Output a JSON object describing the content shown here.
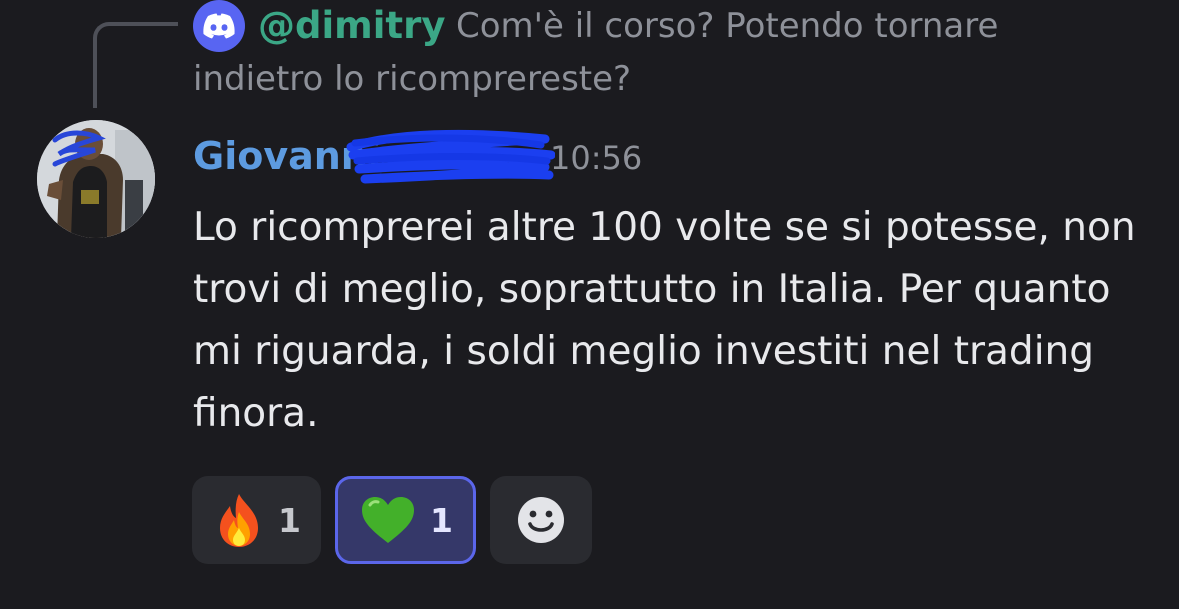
{
  "reply": {
    "author": "@dimitry",
    "text": "Com'è il corso? Potendo tornare indietro lo ricomprereste?",
    "icon": "discord-icon"
  },
  "message": {
    "author_visible": "Giovanni",
    "timestamp": "10:56",
    "body": "Lo ricomprerei altre 100 volte se si potesse, non trovi di meglio, soprattutto in Italia. Per quanto mi riguarda, i soldi meglio investiti nel trading finora."
  },
  "reactions": [
    {
      "emoji": "fire-emoji",
      "count": "1",
      "active": false
    },
    {
      "emoji": "green-heart-emoji",
      "count": "1",
      "active": true
    }
  ],
  "add_reaction": {
    "icon": "smiley-icon"
  },
  "colors": {
    "background": "#1b1b1f",
    "reply_author": "#3ba786",
    "author_name": "#5d9be0",
    "muted_text": "#8e9199",
    "body_text": "#e8e9ec",
    "discord_blurple": "#5865f2",
    "active_reaction_bg": "#353869",
    "active_reaction_border": "#5b66ea"
  }
}
